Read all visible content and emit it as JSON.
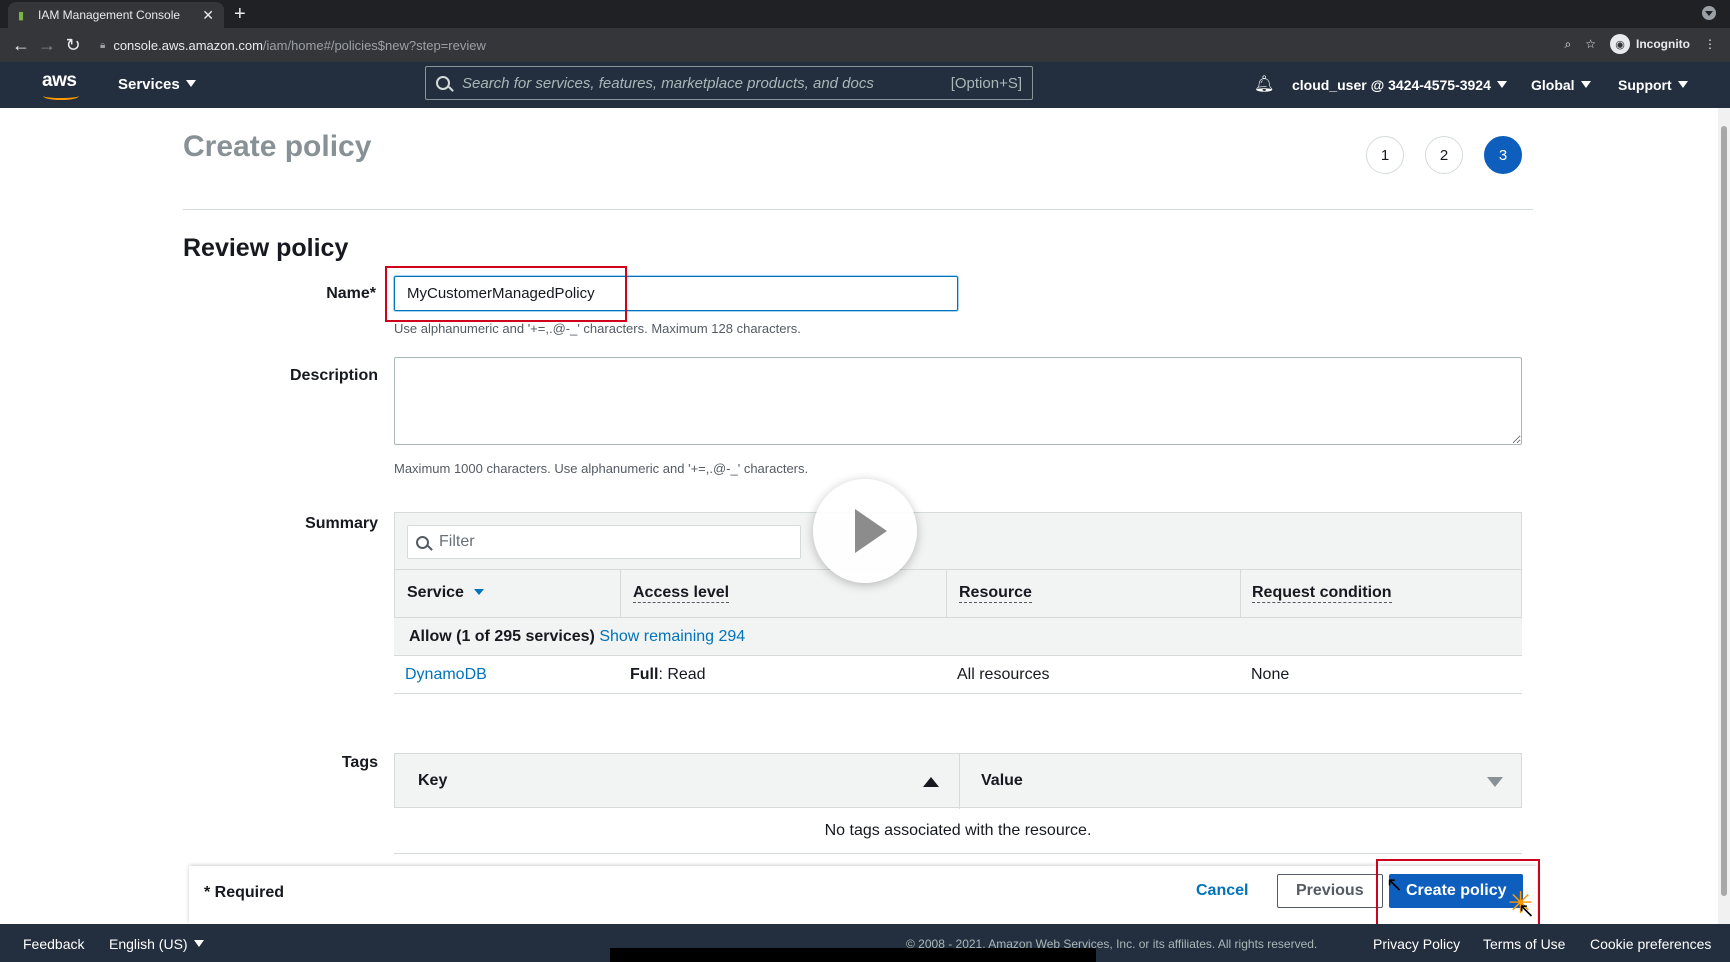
{
  "browser": {
    "tab_title": "IAM Management Console",
    "url_host": "console.aws.amazon.com",
    "url_path": "/iam/home#/policies$new?step=review",
    "profile_label": "Incognito"
  },
  "aws_nav": {
    "logo": "aws",
    "services_label": "Services",
    "search_placeholder": "Search for services, features, marketplace products, and docs",
    "search_shortcut": "[Option+S]",
    "account": "cloud_user @ 3424-4575-3924",
    "region": "Global",
    "support": "Support"
  },
  "page": {
    "title": "Create policy",
    "steps": [
      "1",
      "2",
      "3"
    ],
    "active_step": 3,
    "section_title": "Review policy",
    "name_label": "Name*",
    "name_value": "MyCustomerManagedPolicy",
    "name_hint": "Use alphanumeric and '+=,.@-_' characters. Maximum 128 characters.",
    "description_label": "Description",
    "description_value": "",
    "description_hint": "Maximum 1000 characters. Use alphanumeric and '+=,.@-_' characters.",
    "summary_label": "Summary",
    "filter_placeholder": "Filter",
    "summary_columns": [
      "Service",
      "Access level",
      "Resource",
      "Request condition"
    ],
    "allow_text": "Allow (1 of 295 services)",
    "show_remaining": "Show remaining 294",
    "rows": [
      {
        "service": "DynamoDB",
        "access_bold": "Full",
        "access_rest": ": Read",
        "resource": "All resources",
        "condition": "None"
      }
    ],
    "tags_label": "Tags",
    "tags_columns": [
      "Key",
      "Value"
    ],
    "tags_empty": "No tags associated with the resource.",
    "required_note": "* Required",
    "cancel": "Cancel",
    "previous": "Previous",
    "create": "Create policy"
  },
  "footer": {
    "feedback": "Feedback",
    "language": "English (US)",
    "copyright": "© 2008 - 2021, Amazon Web Services, Inc. or its affiliates. All rights reserved.",
    "privacy": "Privacy Policy",
    "terms": "Terms of Use",
    "cookies": "Cookie preferences"
  },
  "colors": {
    "aws_nav_bg": "#232f3e",
    "primary_button": "#0d5ebd",
    "link": "#0073bb",
    "highlight_box": "#d0021b"
  }
}
